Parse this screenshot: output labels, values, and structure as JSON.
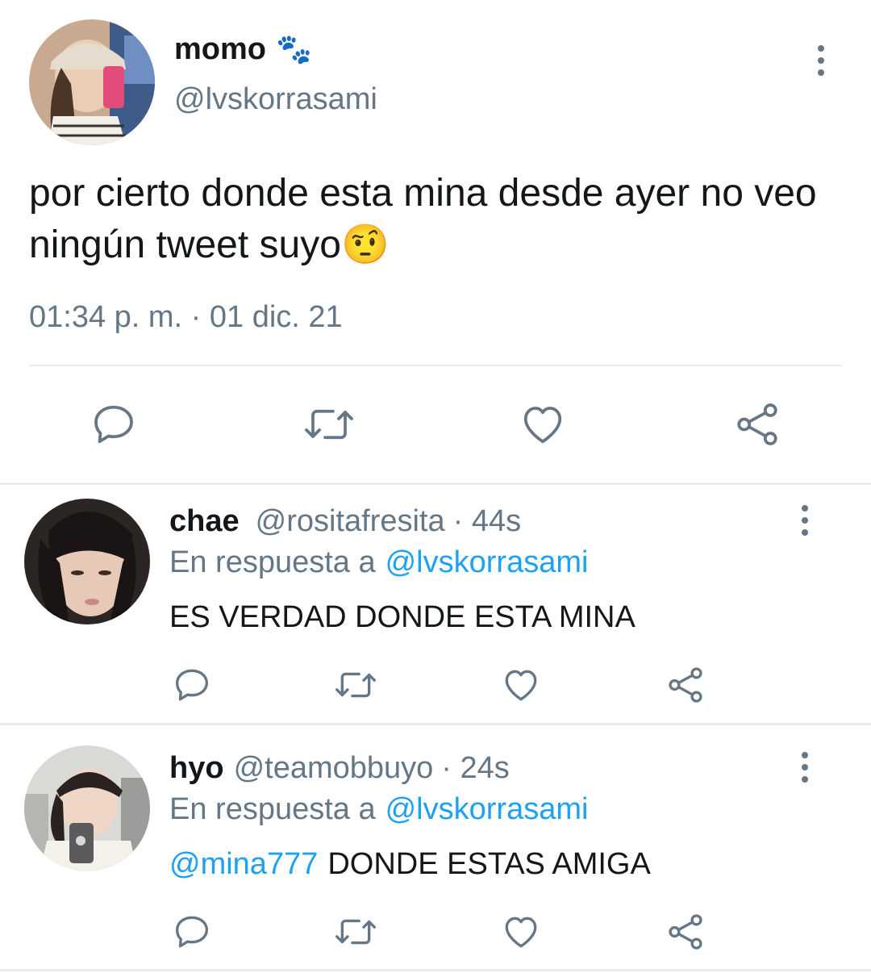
{
  "main_tweet": {
    "display_name": "momo",
    "name_emoji": "🐾",
    "handle": "@lvskorrasami",
    "text": "por cierto donde esta mina desde ayer no veo ningún tweet suyo",
    "text_emoji": "🤨",
    "timestamp": "01:34 p. m. · 01 dic. 21"
  },
  "replies": [
    {
      "display_name": "chae",
      "handle": "@rositafresita",
      "time": "· 44s",
      "reply_prefix": "En respuesta a",
      "reply_to": "@lvskorrasami",
      "mention": "",
      "text": "ES VERDAD DONDE ESTA MINA"
    },
    {
      "display_name": "hyo",
      "handle": "@teamobbuyo",
      "time": "· 24s",
      "reply_prefix": "En respuesta a",
      "reply_to": "@lvskorrasami",
      "mention": "@mina777",
      "text": "DONDE ESTAS AMIGA"
    }
  ],
  "colors": {
    "accent": "#1da1f2",
    "secondary_text": "#657786",
    "icon": "#657786",
    "divider": "#e6ecf0"
  },
  "icons": {
    "reply": "speech-bubble-icon",
    "retweet": "retweet-icon",
    "like": "heart-icon",
    "share": "share-icon",
    "more": "more-vertical-icon"
  }
}
